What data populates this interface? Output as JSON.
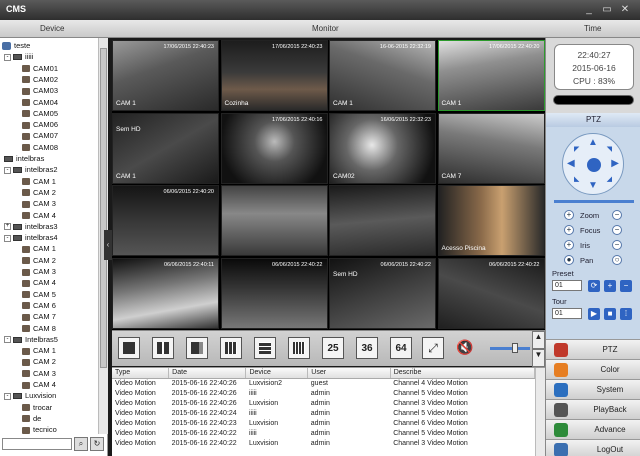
{
  "window": {
    "title": "CMS"
  },
  "header": {
    "device": "Device",
    "monitor": "Monitor",
    "time": "Time"
  },
  "tree": {
    "nodes": [
      {
        "label": "teste",
        "level": 0,
        "kind": "group"
      },
      {
        "label": "iiiii",
        "level": 1,
        "kind": "dvr",
        "expander": "-"
      },
      {
        "label": "CAM01",
        "level": 2,
        "kind": "cam"
      },
      {
        "label": "CAM02",
        "level": 2,
        "kind": "cam"
      },
      {
        "label": "CAM03",
        "level": 2,
        "kind": "cam"
      },
      {
        "label": "CAM04",
        "level": 2,
        "kind": "cam"
      },
      {
        "label": "CAM05",
        "level": 2,
        "kind": "cam"
      },
      {
        "label": "CAM06",
        "level": 2,
        "kind": "cam"
      },
      {
        "label": "CAM07",
        "level": 2,
        "kind": "cam"
      },
      {
        "label": "CAM08",
        "level": 2,
        "kind": "cam"
      },
      {
        "label": "intelbras",
        "level": 1,
        "kind": "dvr"
      },
      {
        "label": "intelbras2",
        "level": 1,
        "kind": "dvr",
        "expander": "-"
      },
      {
        "label": "CAM 1",
        "level": 2,
        "kind": "cam"
      },
      {
        "label": "CAM 2",
        "level": 2,
        "kind": "cam"
      },
      {
        "label": "CAM 3",
        "level": 2,
        "kind": "cam"
      },
      {
        "label": "CAM 4",
        "level": 2,
        "kind": "cam"
      },
      {
        "label": "intelbras3",
        "level": 1,
        "kind": "dvr",
        "expander": "+"
      },
      {
        "label": "intelbras4",
        "level": 1,
        "kind": "dvr",
        "expander": "-"
      },
      {
        "label": "CAM 1",
        "level": 2,
        "kind": "cam"
      },
      {
        "label": "CAM 2",
        "level": 2,
        "kind": "cam"
      },
      {
        "label": "CAM 3",
        "level": 2,
        "kind": "cam"
      },
      {
        "label": "CAM 4",
        "level": 2,
        "kind": "cam"
      },
      {
        "label": "CAM 5",
        "level": 2,
        "kind": "cam"
      },
      {
        "label": "CAM 6",
        "level": 2,
        "kind": "cam"
      },
      {
        "label": "CAM 7",
        "level": 2,
        "kind": "cam"
      },
      {
        "label": "CAM 8",
        "level": 2,
        "kind": "cam"
      },
      {
        "label": "Intelbras5",
        "level": 1,
        "kind": "dvr",
        "expander": "-"
      },
      {
        "label": "CAM 1",
        "level": 2,
        "kind": "cam"
      },
      {
        "label": "CAM 2",
        "level": 2,
        "kind": "cam"
      },
      {
        "label": "CAM 3",
        "level": 2,
        "kind": "cam"
      },
      {
        "label": "CAM 4",
        "level": 2,
        "kind": "cam"
      },
      {
        "label": "Luxvision",
        "level": 1,
        "kind": "dvr",
        "expander": "-"
      },
      {
        "label": "trocar",
        "level": 2,
        "kind": "cam"
      },
      {
        "label": "de",
        "level": 2,
        "kind": "cam"
      },
      {
        "label": "tecnico",
        "level": 2,
        "kind": "cam"
      }
    ]
  },
  "cameras": [
    {
      "label": "CAM 1",
      "ts": "17/06/2015 22:40:23"
    },
    {
      "label": "Cozinha",
      "ts": "17/06/2015 22:40:23"
    },
    {
      "label": "CAM 1",
      "ts": "16-06-2015 22:32:19"
    },
    {
      "label": "CAM 1",
      "ts": "17/06/2015 22:40:20",
      "selected": true
    },
    {
      "label": "CAM 1",
      "ts": "",
      "extra": "Sem HD"
    },
    {
      "label": "",
      "ts": "17/06/2015 22:40:16"
    },
    {
      "label": "CAM02",
      "ts": "16/06/2015 22:32:23"
    },
    {
      "label": "CAM 7",
      "ts": ""
    },
    {
      "label": "",
      "ts": "06/06/2015 22:40:20"
    },
    {
      "label": "",
      "ts": ""
    },
    {
      "label": "",
      "ts": ""
    },
    {
      "label": "Acesso Piscina",
      "ts": ""
    },
    {
      "label": "",
      "ts": "06/06/2015 22:40:11"
    },
    {
      "label": "",
      "ts": "06/06/2015 22:40:22"
    },
    {
      "label": "",
      "ts": "06/06/2015 22:40:22",
      "extra": "Sem HD"
    },
    {
      "label": "",
      "ts": "06/06/2015 22:40:22"
    }
  ],
  "toolbar": {
    "layout_25": "25",
    "layout_36": "36",
    "layout_64": "64"
  },
  "log": {
    "columns": [
      "Type",
      "Date",
      "Device",
      "User",
      "Describe"
    ],
    "rows": [
      [
        "Video Motion",
        "2015-06-16 22:40:26",
        "Luxvision2",
        "guest",
        "Channel 4 Video Motion"
      ],
      [
        "Video Motion",
        "2015-06-16 22:40:26",
        "iiiii",
        "admin",
        "Channel 5 Video Motion"
      ],
      [
        "Video Motion",
        "2015-06-16 22:40:26",
        "Luxvision",
        "admin",
        "Channel 3 Video Motion"
      ],
      [
        "Video Motion",
        "2015-06-16 22:40:24",
        "iiiii",
        "admin",
        "Channel 5 Video Motion"
      ],
      [
        "Video Motion",
        "2015-06-16 22:40:23",
        "Luxvision",
        "admin",
        "Channel 6 Video Motion"
      ],
      [
        "Video Motion",
        "2015-06-16 22:40:22",
        "iiiii",
        "admin",
        "Channel 5 Video Motion"
      ],
      [
        "Video Motion",
        "2015-06-16 22:40:22",
        "Luxvision",
        "admin",
        "Channel 3 Video Motion"
      ]
    ]
  },
  "clock": {
    "time": "22:40:27",
    "date": "2015-06-16",
    "cpu": "CPU : 83%"
  },
  "ptz": {
    "title": "PTZ",
    "zoom": "Zoom",
    "focus": "Focus",
    "iris": "Iris",
    "pan": "Pan",
    "preset": "Preset",
    "preset_value": "01",
    "tour": "Tour",
    "tour_value": "01"
  },
  "menu": [
    {
      "label": "PTZ",
      "color": "#c0392b"
    },
    {
      "label": "Color",
      "color": "#e67e22"
    },
    {
      "label": "System",
      "color": "#2c6fbf"
    },
    {
      "label": "PlayBack",
      "color": "#555555"
    },
    {
      "label": "Advance",
      "color": "#2e8b3a"
    },
    {
      "label": "LogOut",
      "color": "#3b6fb0"
    }
  ]
}
